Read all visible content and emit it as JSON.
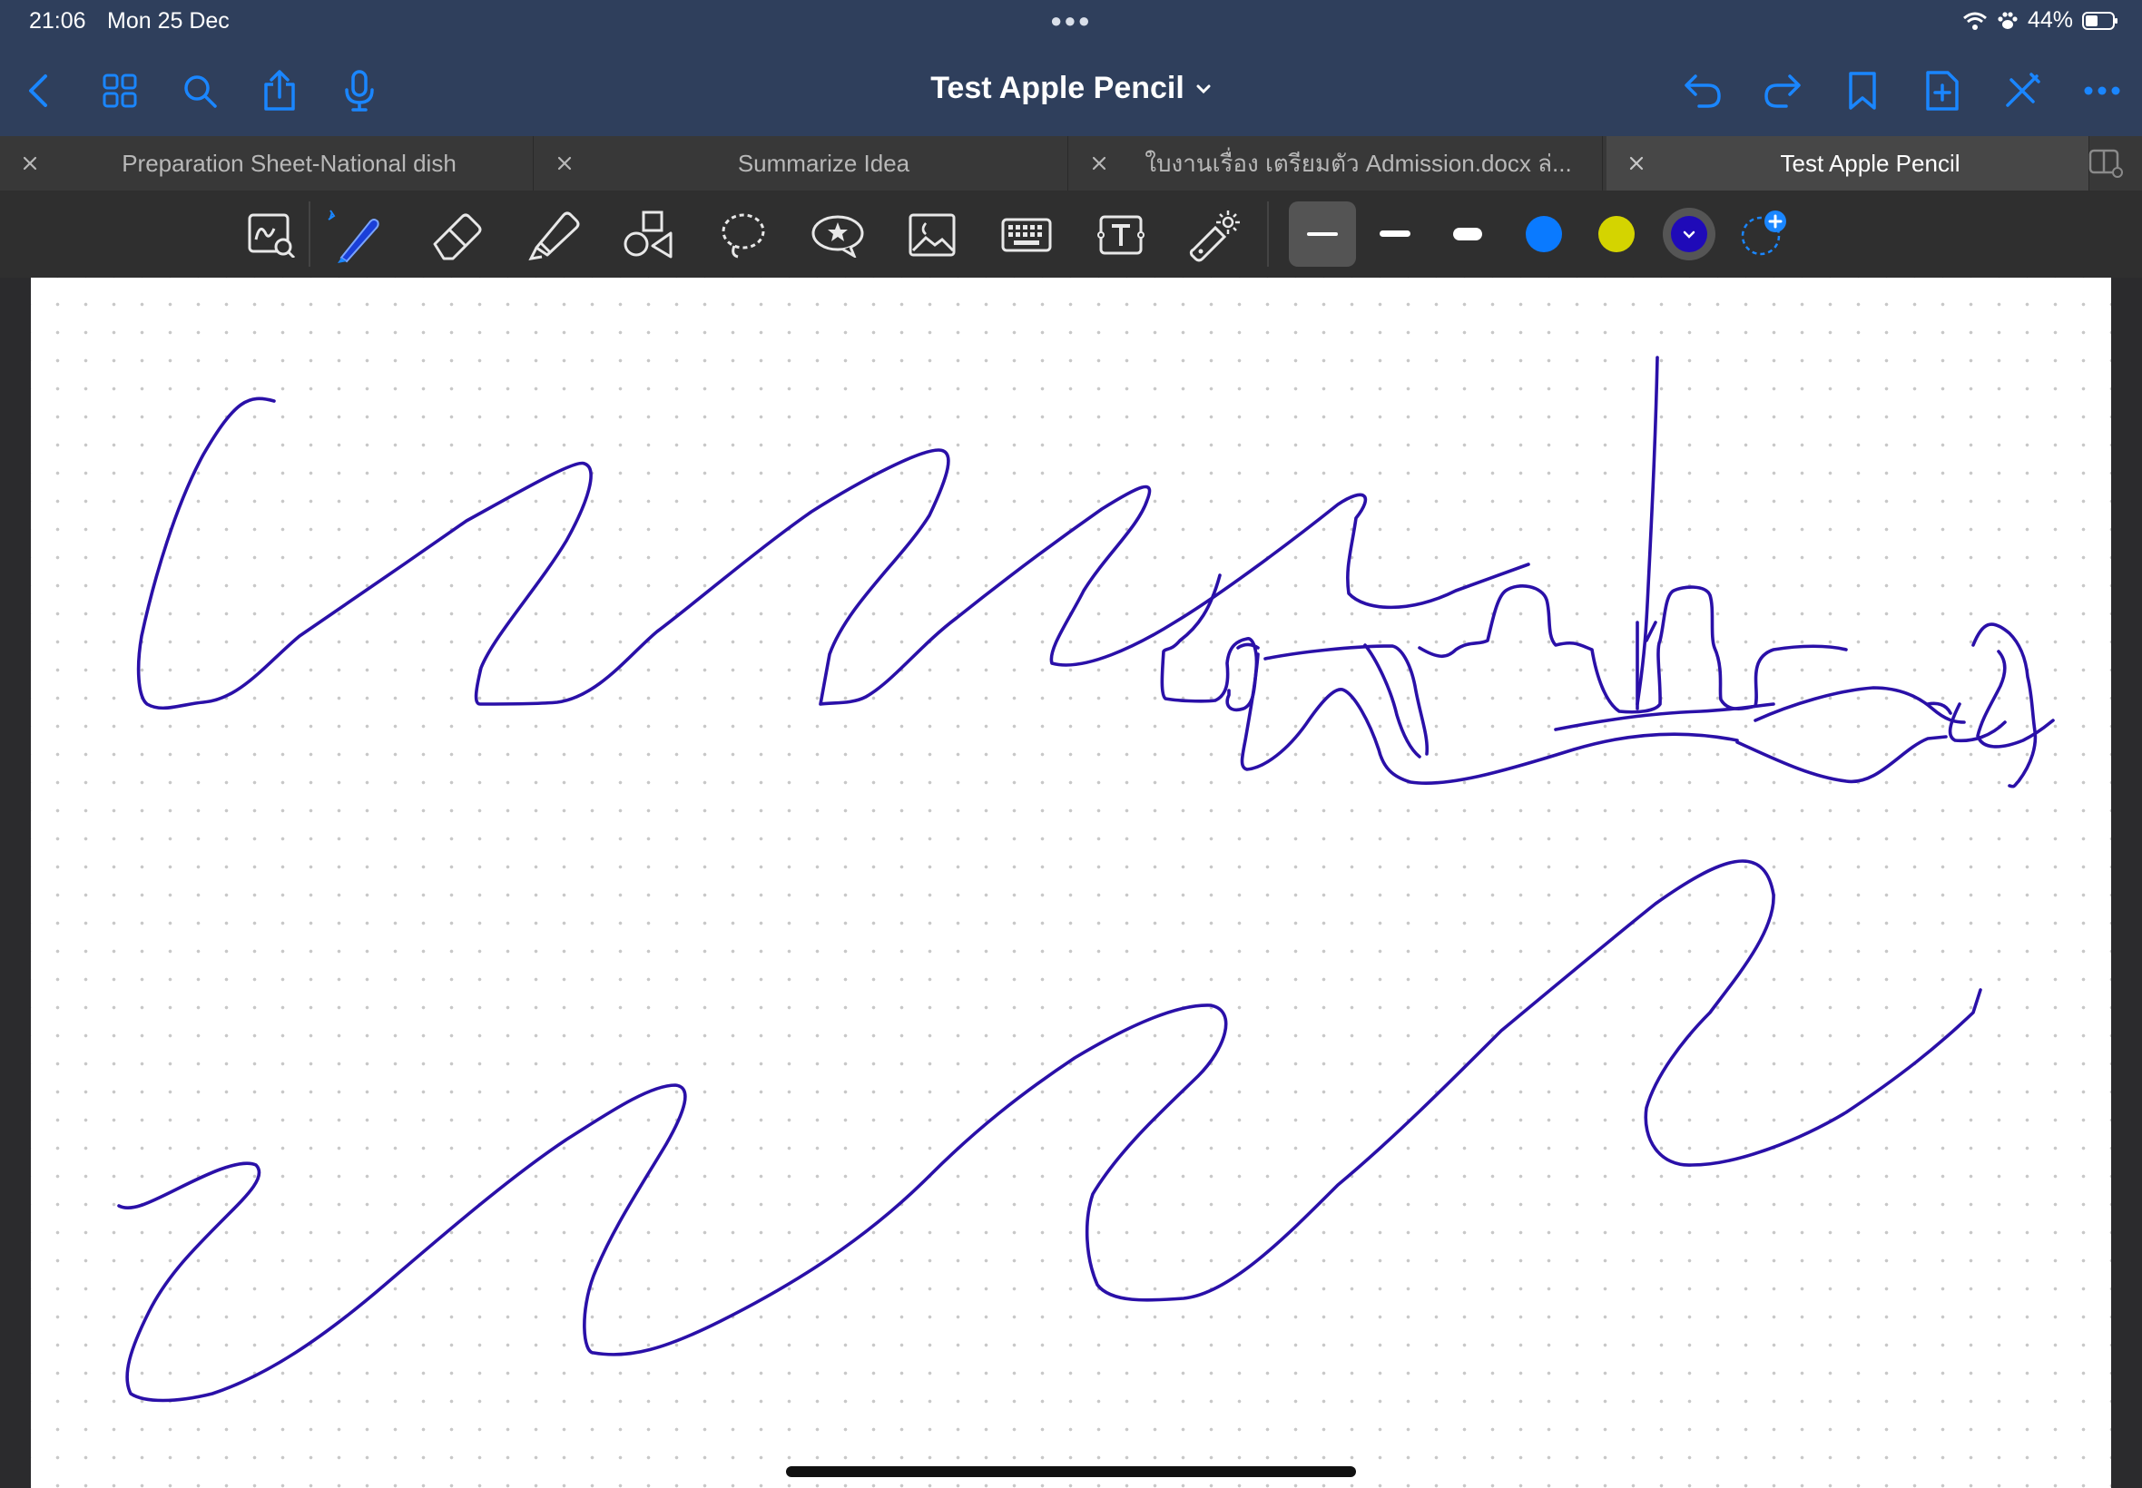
{
  "status_bar": {
    "time": "21:06",
    "date": "Mon 25 Dec",
    "battery": "44%"
  },
  "navbar": {
    "title": "Test Apple Pencil"
  },
  "tabs": [
    {
      "label": "Preparation Sheet-National dish",
      "active": false
    },
    {
      "label": "Summarize Idea",
      "active": false
    },
    {
      "label": "ใบงานเรื่อง เตรียมตัว Admission.docx ล่...",
      "active": false
    },
    {
      "label": "Test Apple Pencil",
      "active": true
    }
  ],
  "toolbar": {
    "tools": [
      "zoom-window-icon",
      "pen-icon",
      "eraser-icon",
      "highlighter-icon",
      "shapes-icon",
      "lasso-icon",
      "sticker-icon",
      "image-icon",
      "keyboard-icon",
      "text-box-icon",
      "laser-pointer-icon"
    ],
    "active_tool": "pen-icon",
    "stroke_widths": [
      "thin",
      "medium",
      "thick"
    ],
    "active_stroke": "thin",
    "colors": [
      "#0a7aff",
      "#d4d400",
      "#1f0ab8"
    ],
    "active_color": "#1f0ab8"
  },
  "colors": {
    "chrome_bg": "#2f3f5c",
    "accent": "#1a86ff",
    "ink": "#2a10a8"
  }
}
